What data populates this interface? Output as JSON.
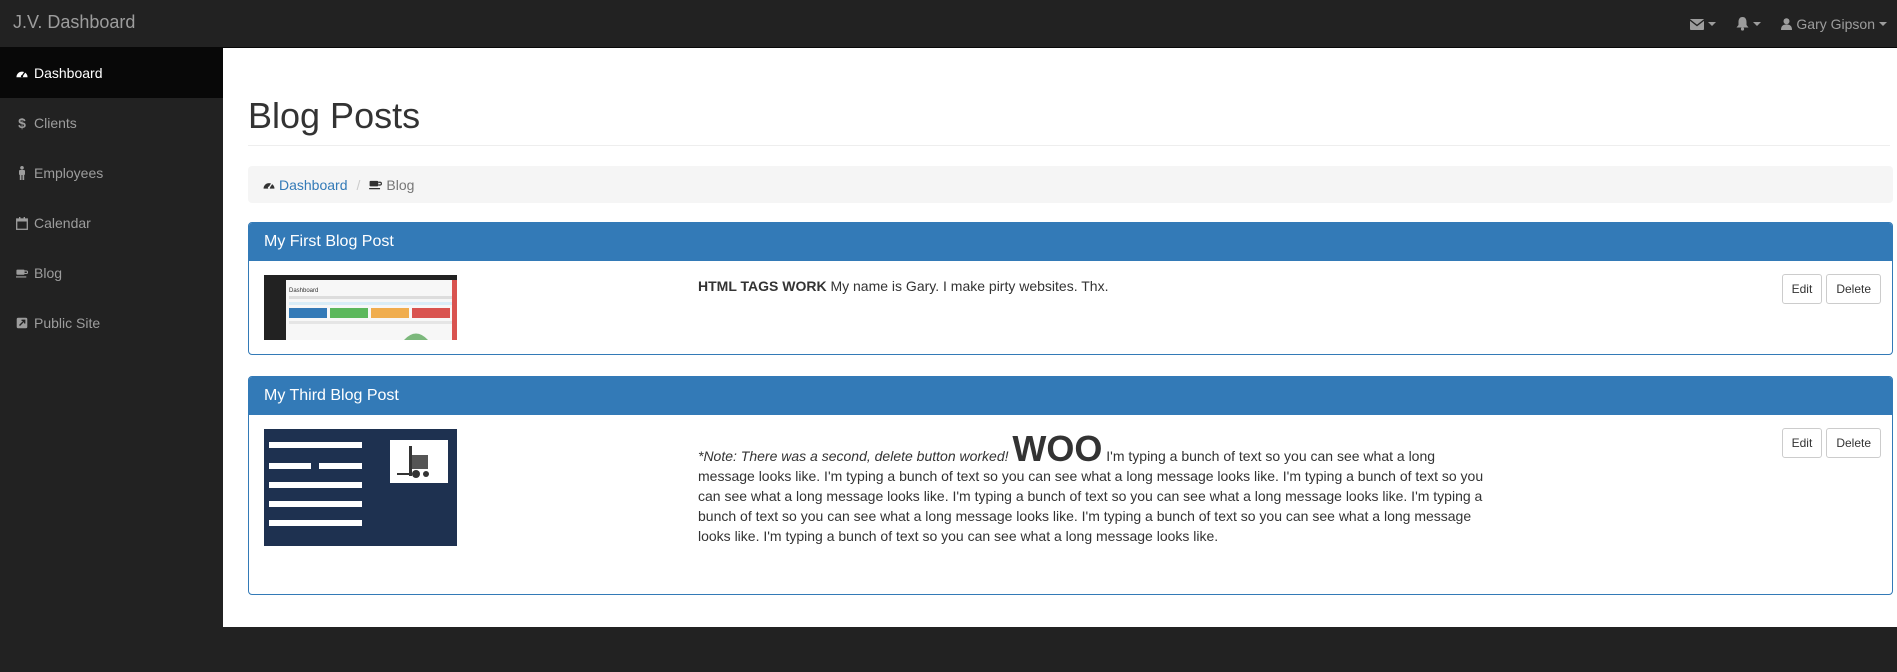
{
  "app": {
    "brand": "J.V. Dashboard"
  },
  "topbar": {
    "items": [
      {
        "icon": "envelope-icon"
      },
      {
        "icon": "bell-icon"
      },
      {
        "icon": "user-icon",
        "label": "Gary Gipson"
      }
    ]
  },
  "sidebar": {
    "items": [
      {
        "label": "Dashboard",
        "icon": "dashboard-icon",
        "active": true
      },
      {
        "label": "Clients",
        "icon": "dollar-icon"
      },
      {
        "label": "Employees",
        "icon": "male-icon"
      },
      {
        "label": "Calendar",
        "icon": "calendar-icon"
      },
      {
        "label": "Blog",
        "icon": "coffee-icon"
      },
      {
        "label": "Public Site",
        "icon": "external-link-icon"
      }
    ]
  },
  "page": {
    "title": "Blog Posts",
    "breadcrumb": {
      "home": "Dashboard",
      "current": "Blog"
    }
  },
  "posts": [
    {
      "title": "My First Blog Post",
      "bold": "HTML TAGS WORK",
      "body": " My name is Gary. I make pirty websites. Thx.",
      "edit": "Edit",
      "delete": "Delete"
    },
    {
      "title": "My Third Blog Post",
      "italic": "*Note: There was a second, delete button worked!",
      "big": "WOO",
      "body": " I'm typing a bunch of text so you can see what a long message looks like. I'm typing a bunch of text so you can see what a long message looks like. I'm typing a bunch of text so you can see what a long message looks like. I'm typing a bunch of text so you can see what a long message looks like. I'm typing a bunch of text so you can see what a long message looks like. I'm typing a bunch of text so you can see what a long message looks like. I'm typing a bunch of text so you can see what a long message looks like.",
      "edit": "Edit",
      "delete": "Delete"
    }
  ],
  "colors": {
    "primary": "#337ab7",
    "navbar": "#222222",
    "active": "#080808"
  }
}
